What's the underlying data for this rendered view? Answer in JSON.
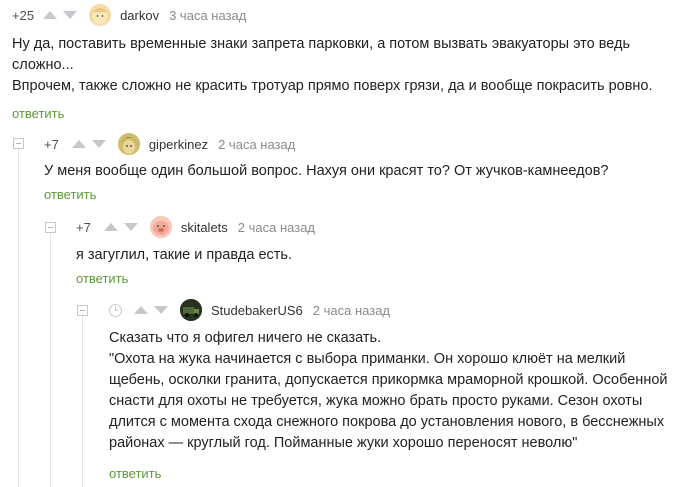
{
  "comments": [
    {
      "rating": "+25",
      "username": "darkov",
      "time": "3 часа назад",
      "avatar_icon": "baby-face-avatar",
      "lines": [
        "Ну да, поставить временные знаки запрета парковки, а потом вызвать эвакуаторы это ведь",
        "сложно...",
        "Впрочем, также сложно не красить тротуар прямо поверх грязи, да и вообще покрасить ровно."
      ],
      "reply_label": "ответить"
    },
    {
      "rating": "+7",
      "username": "giperkinez",
      "time": "2 часа назад",
      "avatar_icon": "character-avatar",
      "lines": [
        "У меня вообще один большой вопрос. Нахуя они красят то? От жучков-камнеедов?"
      ],
      "reply_label": "ответить"
    },
    {
      "rating": "+7",
      "username": "skitalets",
      "time": "2 часа назад",
      "avatar_icon": "pig-avatar",
      "lines": [
        "я загуглил, такие и правда есть."
      ],
      "reply_label": "ответить"
    },
    {
      "rating": "",
      "username": "StudebakerUS6",
      "time": "2 часа назад",
      "avatar_icon": "truck-avatar",
      "lines": [
        "Сказать что я офигел ничего не сказать.",
        "\"Охота на жука начинается с выбора приманки. Он хорошо клюёт на мелкий",
        "щебень, осколки гранита, допускается прикормка мраморной крошкой. Особенной",
        "снасти для охоты не требуется, жука можно брать просто руками. Сезон охоты",
        "длится с момента схода снежного покрова до установления нового, в бесснежных",
        "районах — круглый год. Пойманные жуки хорошо переносят неволю\""
      ],
      "reply_label": "ответить"
    }
  ],
  "colors": {
    "reply_link": "#5c9a36",
    "arrow": "#c4c8cc",
    "time": "#8b8b8b"
  }
}
